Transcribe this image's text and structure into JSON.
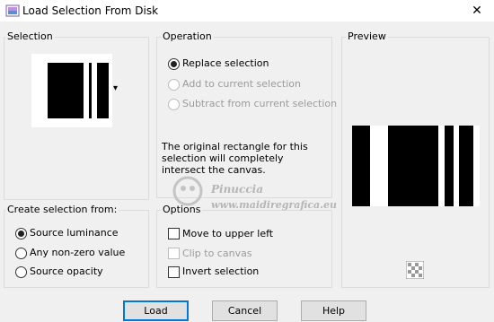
{
  "window": {
    "title": "Load Selection From Disk",
    "close_glyph": "✕"
  },
  "selection": {
    "label": "Selection",
    "dropdown_glyph": "▾"
  },
  "operation": {
    "label": "Operation",
    "options": [
      {
        "label": "Replace selection",
        "checked": true,
        "enabled": true
      },
      {
        "label": "Add to current selection",
        "checked": false,
        "enabled": false
      },
      {
        "label": "Subtract from current selection",
        "checked": false,
        "enabled": false
      }
    ],
    "message": "The original rectangle for this selection will completely intersect the canvas."
  },
  "preview": {
    "label": "Preview",
    "checker_icon": "checkerboard-icon"
  },
  "create_from": {
    "label": "Create selection from:",
    "options": [
      {
        "label": "Source luminance",
        "checked": true
      },
      {
        "label": "Any non-zero value",
        "checked": false
      },
      {
        "label": "Source opacity",
        "checked": false
      }
    ]
  },
  "options": {
    "label": "Options",
    "items": [
      {
        "label": "Move to upper left",
        "checked": false,
        "enabled": true
      },
      {
        "label": "Clip to canvas",
        "checked": false,
        "enabled": false
      },
      {
        "label": "Invert selection",
        "checked": false,
        "enabled": true
      }
    ]
  },
  "watermark": {
    "line1": "Pinuccia",
    "line2": "www.maidiregrafica.eu"
  },
  "buttons": {
    "load": "Load",
    "cancel": "Cancel",
    "help": "Help"
  },
  "colors": {
    "accent": "#0078d7",
    "dialog_bg": "#f0f0f0",
    "group_border": "#dcdcdc"
  }
}
